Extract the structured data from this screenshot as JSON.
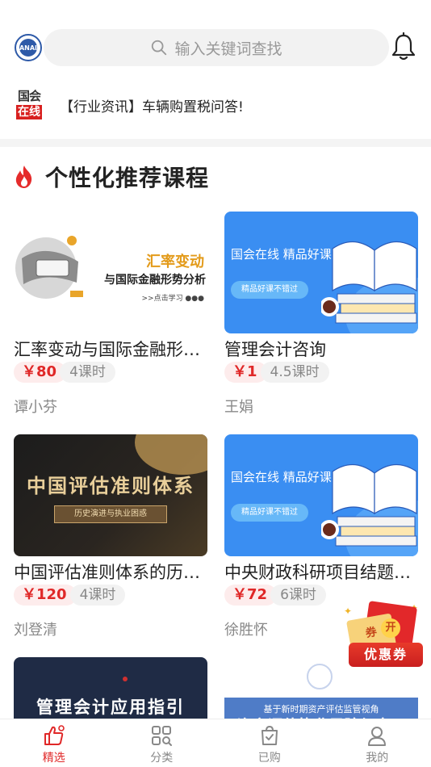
{
  "header": {
    "search_placeholder": "输入关键词查找",
    "logo_text": "ANAI"
  },
  "ticker": {
    "badge_top": "国会",
    "badge_bottom": "在线",
    "text": "【行业资讯】车辆购置税问答!"
  },
  "section": {
    "title": "个性化推荐课程"
  },
  "courses": [
    {
      "title": "汇率变动与国际金融形势分析",
      "price": "￥80",
      "hours": "4课时",
      "teacher": "谭小芬",
      "thumb": {
        "line1": "汇率变动",
        "line2": "与国际金融形势分析",
        "line3": ">>点击学习 ●●●"
      }
    },
    {
      "title": "管理会计咨询",
      "price": "￥1",
      "hours": "4.5课时",
      "teacher": "王娟",
      "thumb": {
        "line1": "国会在线 精品好课",
        "pill": "精品好课不错过"
      }
    },
    {
      "title": "中国评估准则体系的历史演进与执业困惑",
      "price": "￥120",
      "hours": "4课时",
      "teacher": "刘登清",
      "thumb": {
        "line1": "中国评估准则体系",
        "banner": "历史演进与执业困惑"
      }
    },
    {
      "title": "中央财政科研项目结题审计",
      "price": "￥72",
      "hours": "6课时",
      "teacher": "徐胜怀",
      "thumb": {
        "line1": "国会在线 精品好课",
        "pill": "精品好课不错过"
      }
    },
    {
      "title": "",
      "thumb": {
        "line1": "管理会计应用指引"
      }
    },
    {
      "title": "",
      "thumb": {
        "line1": "基于新时期资产评估监管视角",
        "line2": "资产评估执业风险与应用"
      }
    }
  ],
  "coupon": {
    "ticket_text": "券",
    "open_text": "开",
    "label": "优惠券"
  },
  "nav": {
    "items": [
      {
        "label": "精选",
        "icon": "thumbs-up-icon",
        "active": true
      },
      {
        "label": "分类",
        "icon": "category-icon",
        "active": false
      },
      {
        "label": "已购",
        "icon": "purchased-bag-icon",
        "active": false
      },
      {
        "label": "我的",
        "icon": "profile-icon",
        "active": false
      }
    ]
  },
  "colors": {
    "accent": "#e02828",
    "brand_blue": "#2e5aa8",
    "thumb_blue": "#3a8ef2"
  }
}
